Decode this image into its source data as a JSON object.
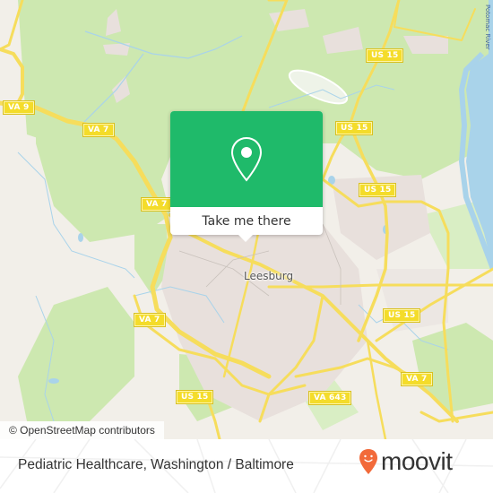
{
  "map": {
    "city_label": "Leesburg",
    "river_label": "Potomac River",
    "route_shields": [
      {
        "id": "va9",
        "label": "VA 9"
      },
      {
        "id": "va7-nw",
        "label": "VA 7"
      },
      {
        "id": "va7-n",
        "label": "VA 7"
      },
      {
        "id": "va7-w",
        "label": "VA 7"
      },
      {
        "id": "va7-se",
        "label": "VA 7"
      },
      {
        "id": "us15-n1",
        "label": "US 15"
      },
      {
        "id": "us15-n2",
        "label": "US 15"
      },
      {
        "id": "us15-n3",
        "label": "US 15"
      },
      {
        "id": "us15-e",
        "label": "US 15"
      },
      {
        "id": "us15-s",
        "label": "US 15"
      },
      {
        "id": "va643",
        "label": "VA 643"
      }
    ],
    "colors": {
      "land": "#f2efe9",
      "park": "#cde8b0",
      "water": "#a9d3ea",
      "road": "#f6dd5c",
      "residential": "#e8e0dc"
    }
  },
  "popup": {
    "icon": "map-pin-icon",
    "cta_label": "Take me there",
    "accent_color": "#1fba6a"
  },
  "attribution": "© OpenStreetMap contributors",
  "footer": {
    "title": "Pediatric Healthcare, Washington / Baltimore",
    "logo_text": "moovit",
    "logo_color": "#f26a3a"
  }
}
